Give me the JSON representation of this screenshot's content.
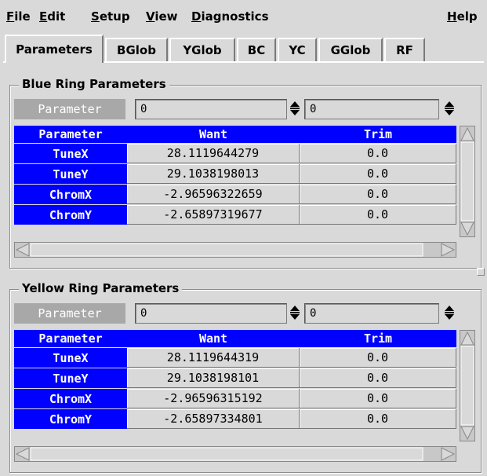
{
  "menu": {
    "file": "File",
    "edit": "Edit",
    "setup": "Setup",
    "view": "View",
    "diagnostics": "Diagnostics",
    "help": "Help"
  },
  "tabs": [
    "Parameters",
    "BGlob",
    "YGlob",
    "BC",
    "YC",
    "GGlob",
    "RF"
  ],
  "active_tab": "Parameters",
  "blue": {
    "title": "Blue Ring Parameters",
    "param_button": "Parameter",
    "entry1": "0",
    "entry2": "0",
    "columns": [
      "Parameter",
      "Want",
      "Trim"
    ],
    "rows": [
      {
        "name": "TuneX",
        "want": "28.1119644279",
        "trim": "0.0"
      },
      {
        "name": "TuneY",
        "want": "29.1038198013",
        "trim": "0.0"
      },
      {
        "name": "ChromX",
        "want": "-2.96596322659",
        "trim": "0.0"
      },
      {
        "name": "ChromY",
        "want": "-2.65897319677",
        "trim": "0.0"
      }
    ]
  },
  "yellow": {
    "title": "Yellow Ring Parameters",
    "param_button": "Parameter",
    "entry1": "0",
    "entry2": "0",
    "columns": [
      "Parameter",
      "Want",
      "Trim"
    ],
    "rows": [
      {
        "name": "TuneX",
        "want": "28.1119644319",
        "trim": "0.0"
      },
      {
        "name": "TuneY",
        "want": "29.1038198101",
        "trim": "0.0"
      },
      {
        "name": "ChromX",
        "want": "-2.96596315192",
        "trim": "0.0"
      },
      {
        "name": "ChromY",
        "want": "-2.65897334801",
        "trim": "0.0"
      }
    ]
  },
  "colors": {
    "header_blue": "#0000ff",
    "background": "#d9d9d9",
    "param_button_bg": "#a8a8a8"
  }
}
